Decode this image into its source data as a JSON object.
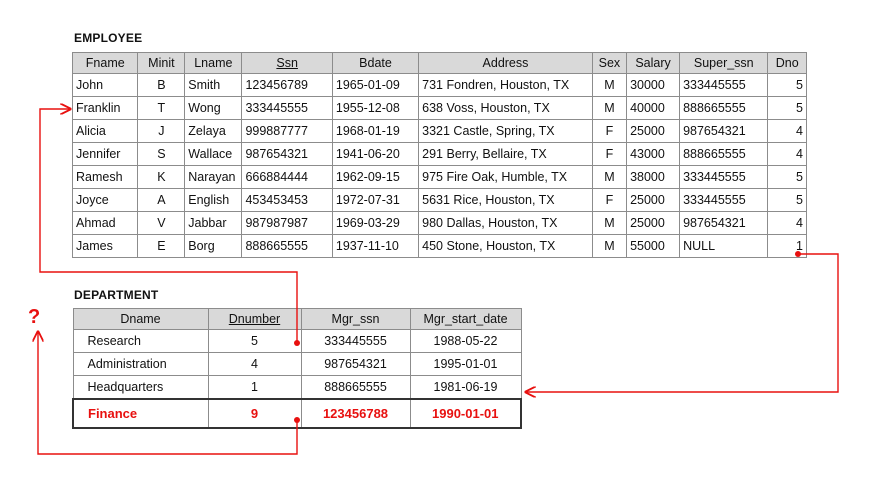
{
  "employee": {
    "title": "EMPLOYEE",
    "columns": [
      "Fname",
      "Minit",
      "Lname",
      "Ssn",
      "Bdate",
      "Address",
      "Sex",
      "Salary",
      "Super_ssn",
      "Dno"
    ],
    "rows": [
      [
        "John",
        "B",
        "Smith",
        "123456789",
        "1965-01-09",
        "731 Fondren, Houston, TX",
        "M",
        "30000",
        "333445555",
        "5"
      ],
      [
        "Franklin",
        "T",
        "Wong",
        "333445555",
        "1955-12-08",
        "638 Voss, Houston, TX",
        "M",
        "40000",
        "888665555",
        "5"
      ],
      [
        "Alicia",
        "J",
        "Zelaya",
        "999887777",
        "1968-01-19",
        "3321 Castle, Spring, TX",
        "F",
        "25000",
        "987654321",
        "4"
      ],
      [
        "Jennifer",
        "S",
        "Wallace",
        "987654321",
        "1941-06-20",
        "291 Berry, Bellaire, TX",
        "F",
        "43000",
        "888665555",
        "4"
      ],
      [
        "Ramesh",
        "K",
        "Narayan",
        "666884444",
        "1962-09-15",
        "975 Fire Oak, Humble, TX",
        "M",
        "38000",
        "333445555",
        "5"
      ],
      [
        "Joyce",
        "A",
        "English",
        "453453453",
        "1972-07-31",
        "5631 Rice, Houston, TX",
        "F",
        "25000",
        "333445555",
        "5"
      ],
      [
        "Ahmad",
        "V",
        "Jabbar",
        "987987987",
        "1969-03-29",
        "980 Dallas, Houston, TX",
        "M",
        "25000",
        "987654321",
        "4"
      ],
      [
        "James",
        "E",
        "Borg",
        "888665555",
        "1937-11-10",
        "450 Stone, Houston, TX",
        "M",
        "55000",
        "NULL",
        "1"
      ]
    ]
  },
  "department": {
    "title": "DEPARTMENT",
    "columns": [
      "Dname",
      "Dnumber",
      "Mgr_ssn",
      "Mgr_start_date"
    ],
    "rows": [
      [
        "Research",
        "5",
        "333445555",
        "1988-05-22"
      ],
      [
        "Administration",
        "4",
        "987654321",
        "1995-01-01"
      ],
      [
        "Headquarters",
        "1",
        "888665555",
        "1981-06-19"
      ]
    ],
    "new_row": [
      "Finance",
      "9",
      "123456788",
      "1990-01-01"
    ]
  },
  "annotation": {
    "question_mark": "?"
  },
  "colors": {
    "accent": "#e8100f",
    "header_bg": "#d9d9d9",
    "border": "#8c8c8c"
  }
}
